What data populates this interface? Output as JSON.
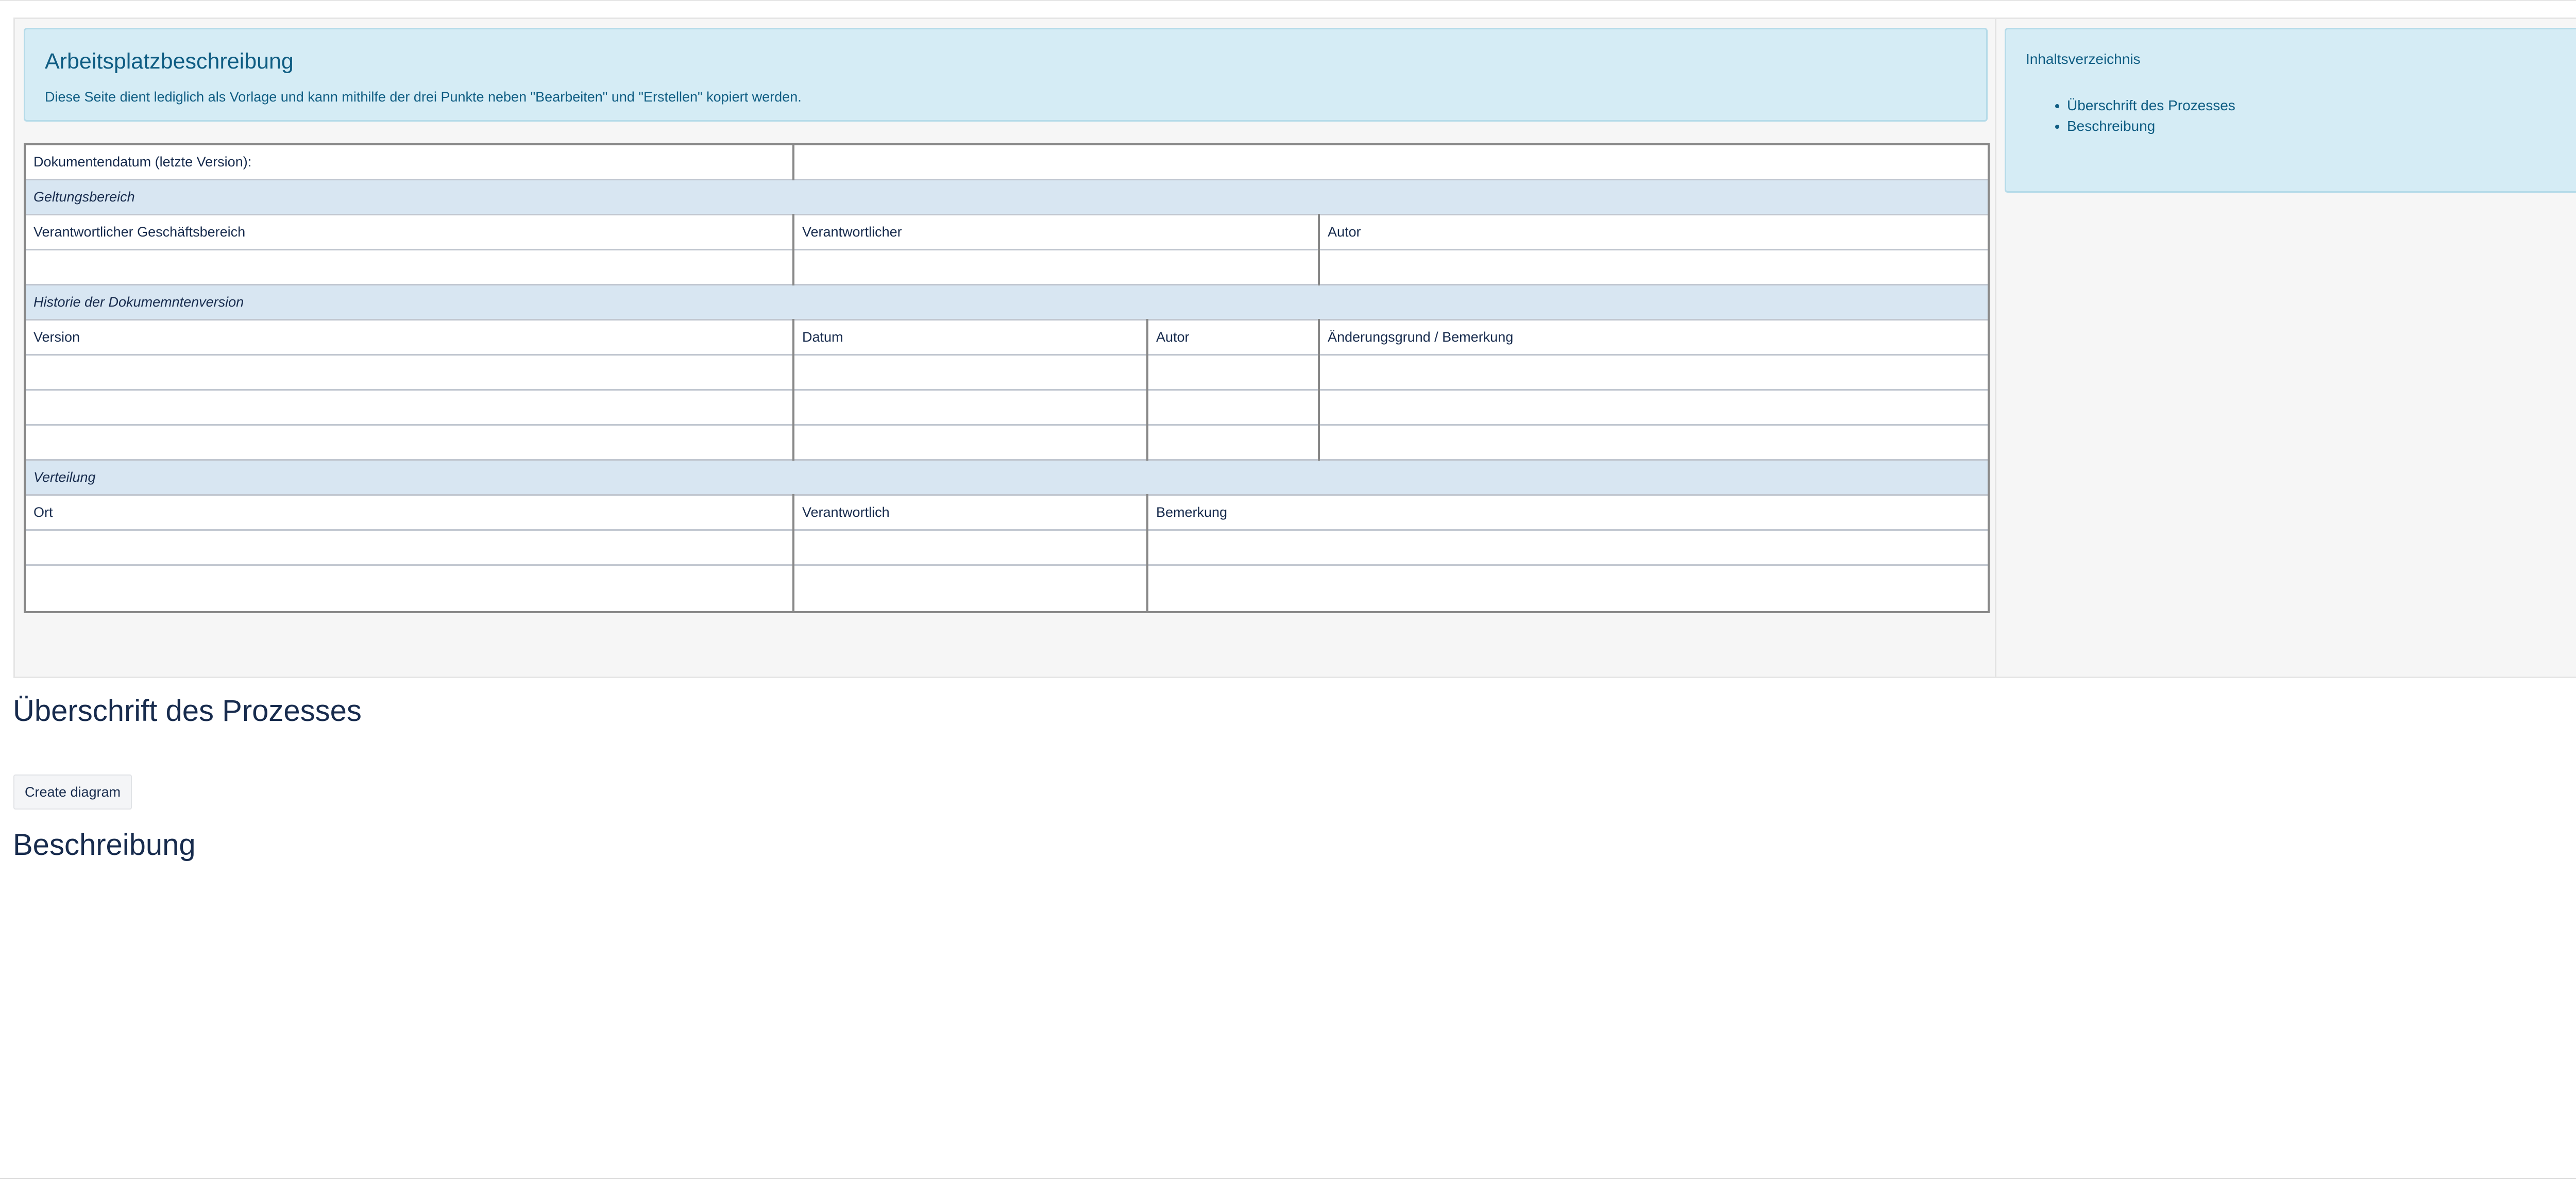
{
  "info_panel": {
    "title": "Arbeitsplatzbeschreibung",
    "text": "Diese Seite dient lediglich als Vorlage und kann mithilfe der drei Punkte neben \"Bearbeiten\" und \"Erstellen\" kopiert werden."
  },
  "toc": {
    "title": "Inhaltsverzeichnis",
    "items": [
      "Überschrift des Prozesses",
      "Beschreibung"
    ]
  },
  "table": {
    "document_date_label": "Dokumentendatum (letzte Version):",
    "document_date_value": "",
    "scope": {
      "section": "Geltungsbereich",
      "headers": [
        "Verantwortlicher Geschäftsbereich",
        "Verantwortlicher",
        "Autor"
      ]
    },
    "history": {
      "section": "Historie der Dokumemntenversion",
      "headers": [
        "Version",
        "Datum",
        "Autor",
        "Änderungsgrund / Bemerkung"
      ]
    },
    "distribution": {
      "section": "Verteilung",
      "headers": [
        "Ort",
        "Verantwortlich",
        "Bemerkung"
      ]
    }
  },
  "headings": {
    "process": "Überschrift des Prozesses",
    "description": "Beschreibung"
  },
  "buttons": {
    "create_diagram": "Create diagram"
  }
}
